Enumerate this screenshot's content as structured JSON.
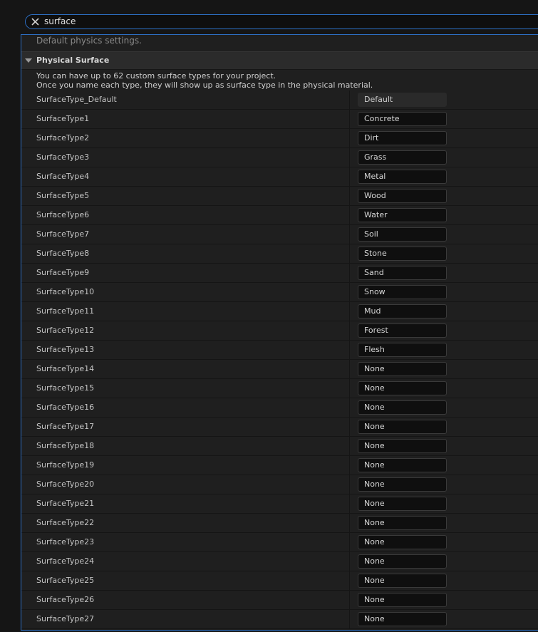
{
  "search": {
    "query": "surface",
    "clear_icon": "close-icon"
  },
  "panel": {
    "description": "Default physics settings.",
    "section_title": "Physical Surface",
    "help_line1": "You can have up to 62 custom surface types for your project.",
    "help_line2": "Once you name each type, they will show up as surface type in the physical material."
  },
  "rows": [
    {
      "label": "SurfaceType_Default",
      "value": "Default"
    },
    {
      "label": "SurfaceType1",
      "value": "Concrete"
    },
    {
      "label": "SurfaceType2",
      "value": "Dirt"
    },
    {
      "label": "SurfaceType3",
      "value": "Grass"
    },
    {
      "label": "SurfaceType4",
      "value": "Metal"
    },
    {
      "label": "SurfaceType5",
      "value": "Wood"
    },
    {
      "label": "SurfaceType6",
      "value": "Water"
    },
    {
      "label": "SurfaceType7",
      "value": "Soil"
    },
    {
      "label": "SurfaceType8",
      "value": "Stone"
    },
    {
      "label": "SurfaceType9",
      "value": "Sand"
    },
    {
      "label": "SurfaceType10",
      "value": "Snow"
    },
    {
      "label": "SurfaceType11",
      "value": "Mud"
    },
    {
      "label": "SurfaceType12",
      "value": "Forest"
    },
    {
      "label": "SurfaceType13",
      "value": "Flesh"
    },
    {
      "label": "SurfaceType14",
      "value": "None"
    },
    {
      "label": "SurfaceType15",
      "value": "None"
    },
    {
      "label": "SurfaceType16",
      "value": "None"
    },
    {
      "label": "SurfaceType17",
      "value": "None"
    },
    {
      "label": "SurfaceType18",
      "value": "None"
    },
    {
      "label": "SurfaceType19",
      "value": "None"
    },
    {
      "label": "SurfaceType20",
      "value": "None"
    },
    {
      "label": "SurfaceType21",
      "value": "None"
    },
    {
      "label": "SurfaceType22",
      "value": "None"
    },
    {
      "label": "SurfaceType23",
      "value": "None"
    },
    {
      "label": "SurfaceType24",
      "value": "None"
    },
    {
      "label": "SurfaceType25",
      "value": "None"
    },
    {
      "label": "SurfaceType26",
      "value": "None"
    },
    {
      "label": "SurfaceType27",
      "value": "None"
    }
  ],
  "colors": {
    "accent": "#2d6fc4",
    "panel_bg": "#1f1f1f",
    "input_bg": "#0f0f0f"
  }
}
